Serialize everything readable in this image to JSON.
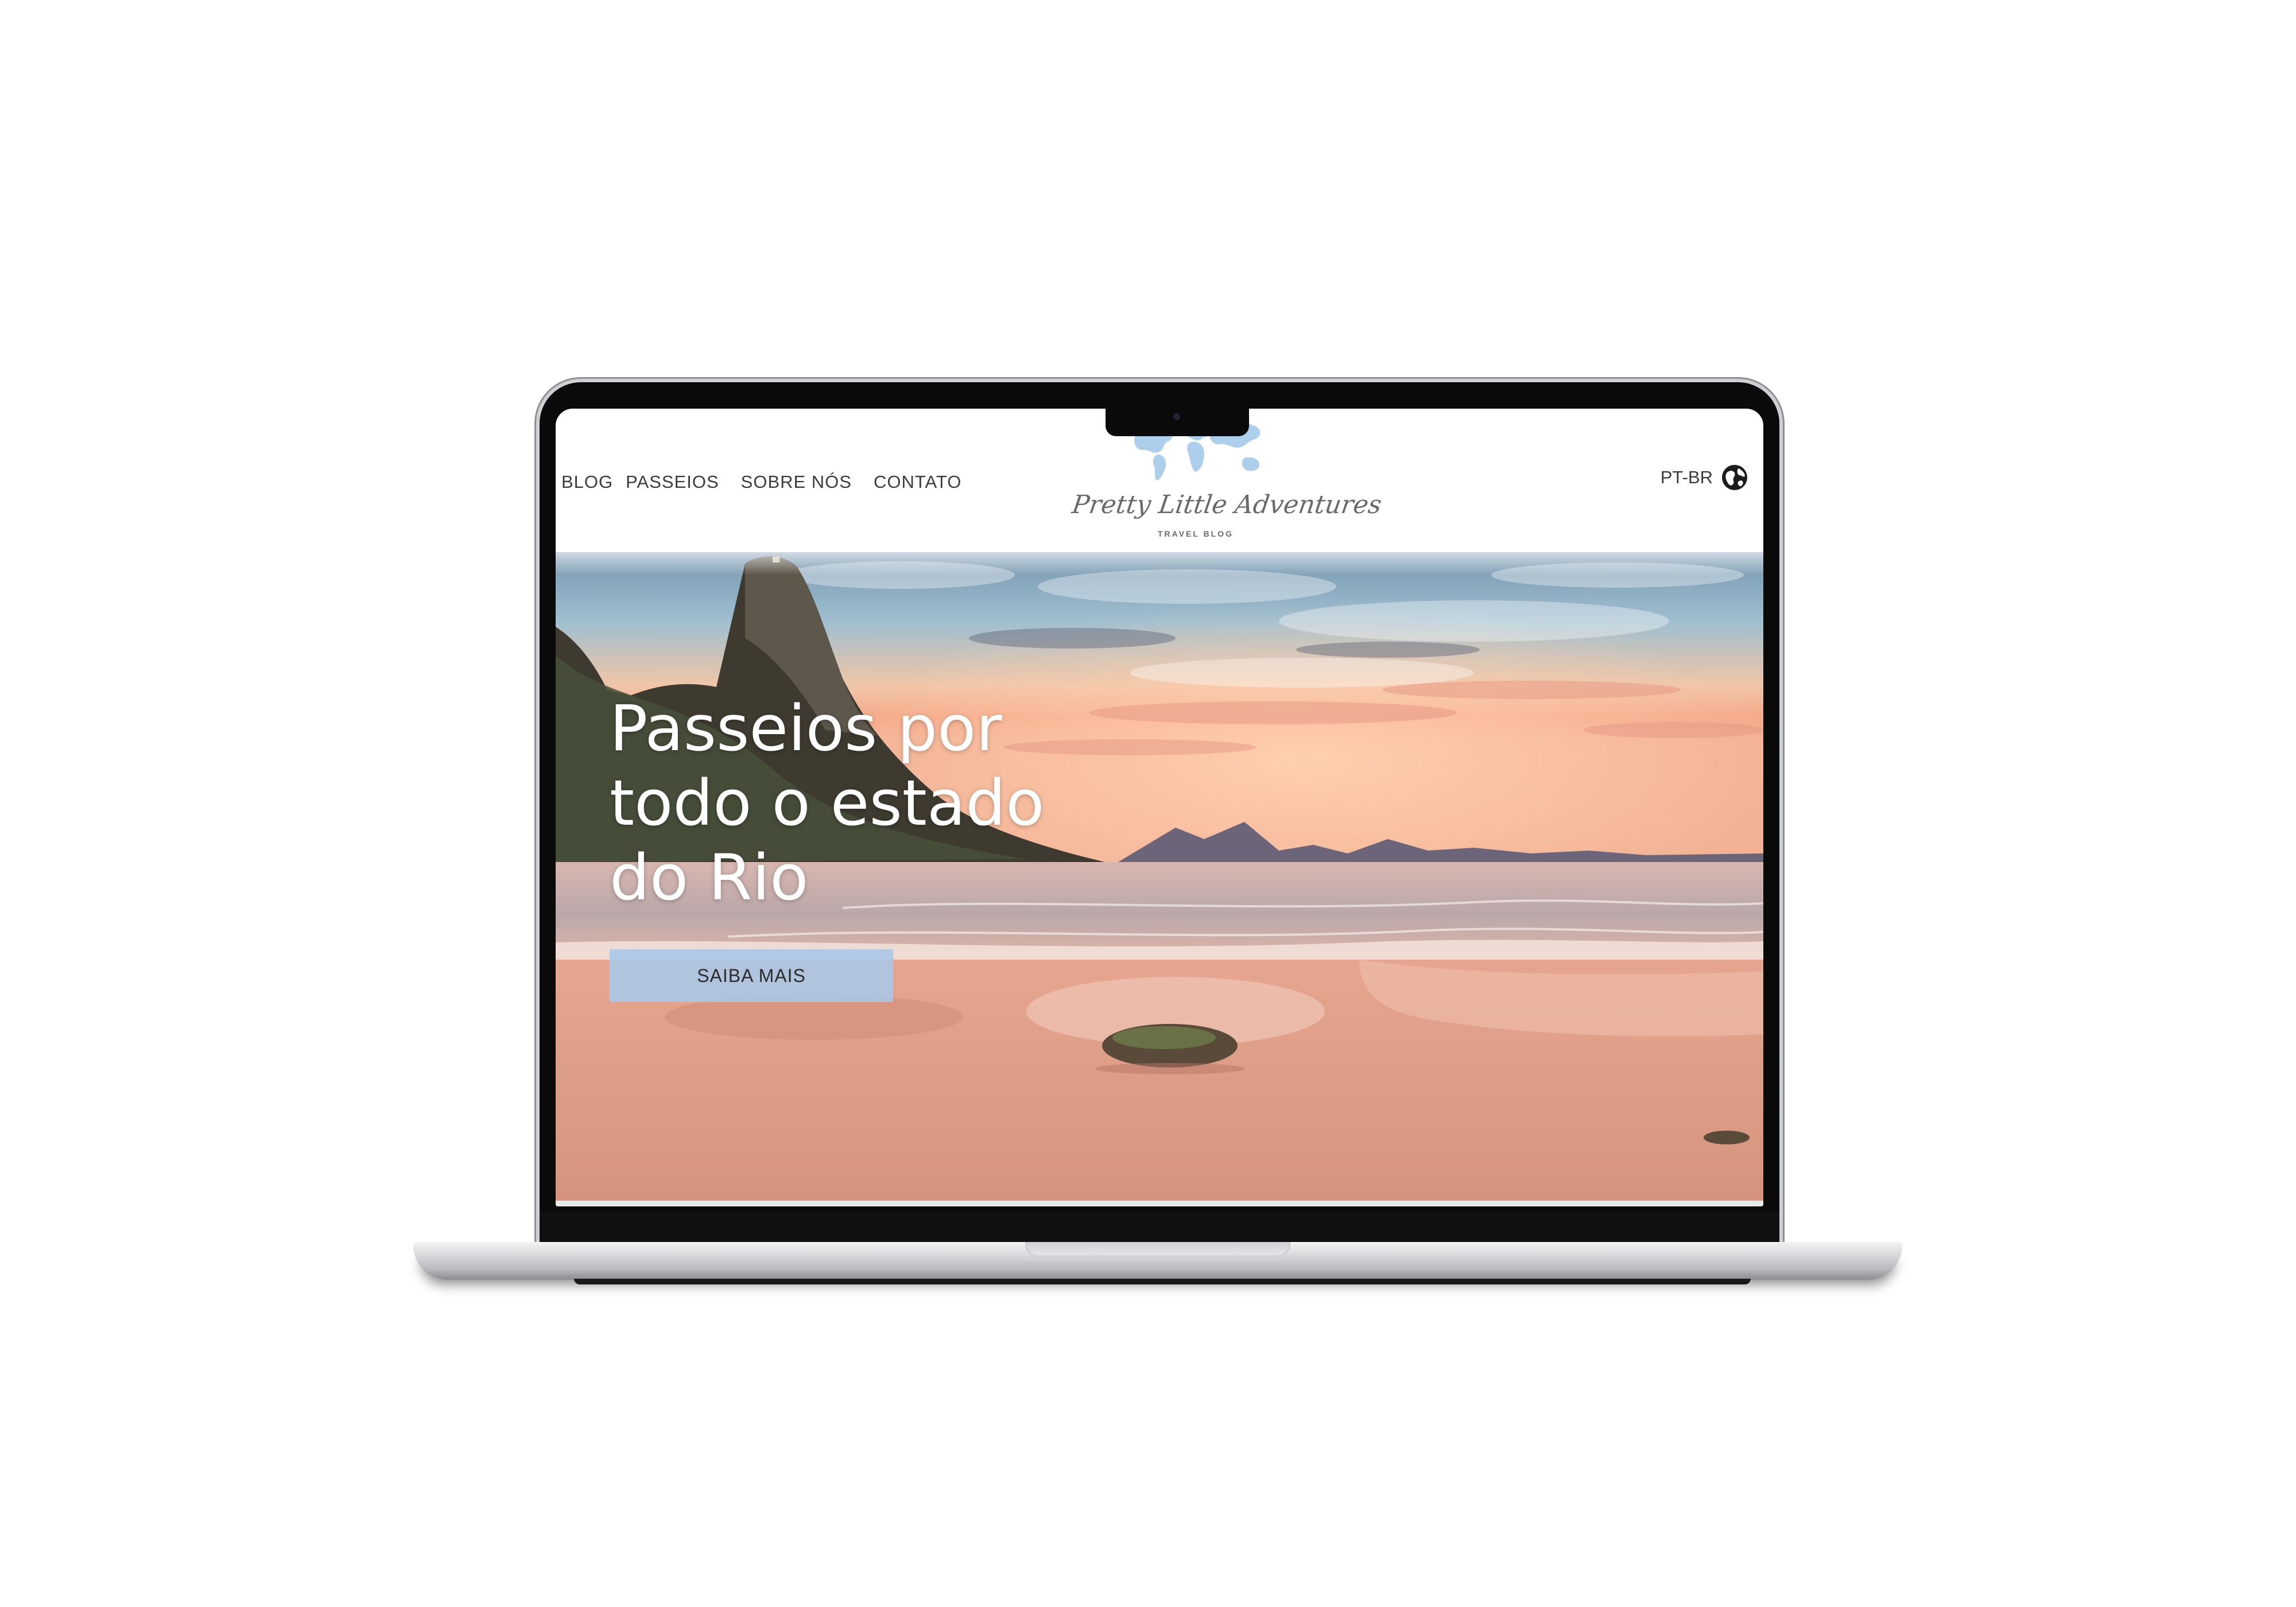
{
  "nav": {
    "items": [
      {
        "label": "BLOG"
      },
      {
        "label": "PASSEIOS"
      },
      {
        "label": "SOBRE NÓS"
      },
      {
        "label": "CONTATO"
      }
    ]
  },
  "logo": {
    "script": "Pretty Little Adventures",
    "tagline": "TRAVEL BLOG",
    "icon": "world-map-icon"
  },
  "language": {
    "label": "PT-BR",
    "icon": "globe-icon"
  },
  "hero": {
    "title_lines": [
      "Passeios por",
      "todo o estado",
      "do Rio"
    ],
    "cta_label": "SAIBA MAIS"
  },
  "colors": {
    "accent": "#a8c8e8",
    "text": "#3c3c3c",
    "hero_text": "#ffffff"
  }
}
